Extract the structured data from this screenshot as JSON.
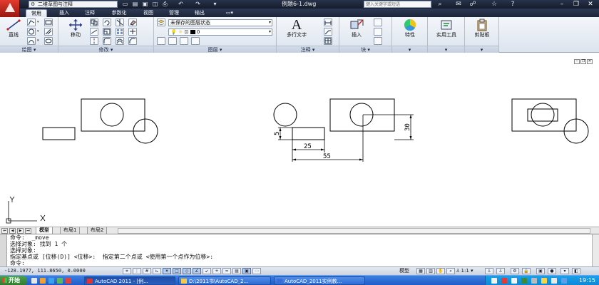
{
  "titlebar": {
    "workspace": "二维草图与注释",
    "document_title": "例题6-1.dwg",
    "search_placeholder": "键入关键字或短语"
  },
  "ribbon_tabs": [
    "常用",
    "插入",
    "注释",
    "参数化",
    "视图",
    "管理",
    "输出"
  ],
  "ribbon_active_tab": "常用",
  "panels": {
    "draw": {
      "title": "绘图",
      "line_label": "直线"
    },
    "modify": {
      "title": "修改",
      "move_label": "移动"
    },
    "layers": {
      "title": "图层",
      "layer_state": "未保存的图层状态",
      "current_layer": "0"
    },
    "annotation": {
      "title": "注释",
      "mtext_label": "多行文字"
    },
    "block": {
      "title": "块",
      "insert_label": "插入"
    },
    "properties": {
      "label": "特性"
    },
    "utilities": {
      "label": "实用工具"
    },
    "clipboard": {
      "label": "剪贴板"
    }
  },
  "drawing": {
    "dim_25": "25",
    "dim_55": "55",
    "dim_30": "30",
    "dim_5": "5",
    "ucs_x": "X",
    "ucs_y": "Y"
  },
  "layout_tabs": [
    "模型",
    "布局1",
    "布局2"
  ],
  "command_lines": [
    "命令:  _move",
    "选择对象: 找到 1 个",
    "选择对象:",
    "指定基点或 [位移(D)] <位移>:  指定第二个点或 <使用第一个点作为位移>:",
    "命令:"
  ],
  "statusbar": {
    "coordinates": "-128.1977, 111.8650, 0.0000",
    "model_label": "模型",
    "annotation_scale": "1:1"
  },
  "taskbar": {
    "start_label": "开始",
    "tasks": [
      "AutoCAD 2011 - [例...",
      "D:\\2011书\\AutoCAD_2...",
      "AutoCAD_2011实例教..."
    ],
    "clock": "19:15"
  },
  "colors": {
    "titlebar": "#1e273a",
    "ribbon": "#e4eaf2",
    "canvas": "#ffffff",
    "taskbar": "#245edb",
    "start": "#3a8c3a"
  }
}
